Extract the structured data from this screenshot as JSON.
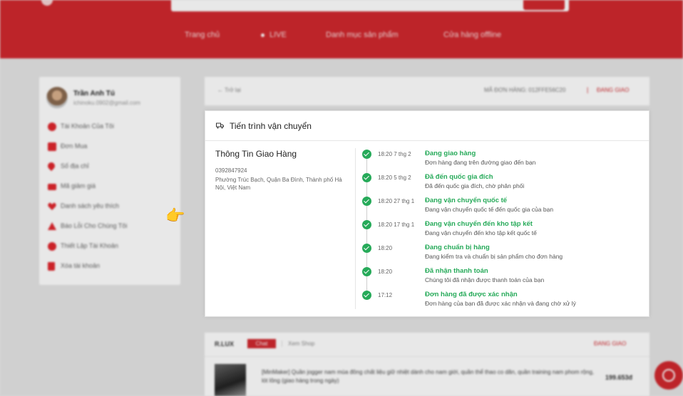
{
  "header": {
    "nav": [
      {
        "label": "Trang chủ"
      },
      {
        "label": "LIVE"
      },
      {
        "label": "Danh mục sản phẩm"
      },
      {
        "label": "Cửa hàng offline"
      }
    ]
  },
  "profile": {
    "name": "Trần Anh Tú",
    "email": "ichinoku.0902@gmail.com"
  },
  "sidebar": {
    "items": [
      {
        "label": "Tài Khoản Của Tôi",
        "icon": "user-circle-icon"
      },
      {
        "label": "Đơn Mua",
        "icon": "clipboard-icon"
      },
      {
        "label": "Số địa chỉ",
        "icon": "location-pin-icon"
      },
      {
        "label": "Mã giảm giá",
        "icon": "ticket-icon"
      },
      {
        "label": "Danh sách yêu thích",
        "icon": "heart-icon"
      },
      {
        "label": "Báo Lỗi Cho Chúng Tôi",
        "icon": "warning-icon"
      },
      {
        "label": "Thiết Lập Tài Khoản",
        "icon": "settings-icon"
      },
      {
        "label": "Xóa tài khoản",
        "icon": "trash-icon"
      }
    ]
  },
  "order_bar": {
    "back_label": "← Trở lại",
    "order_id": "MÃ ĐƠN HÀNG: 012FFE56C20",
    "separator": "|",
    "status": "ĐANG GIAO"
  },
  "shipping": {
    "title": "Tiến trình vận chuyển",
    "info_title": "Thông Tin Giao Hàng",
    "phone": "0392847924",
    "address": "Phường Trúc Bạch, Quận Ba Đình, Thành phố Hà Nội, Việt Nam",
    "events": [
      {
        "time": "18:20 7 thg 2",
        "status": "Đang giao hàng",
        "desc": "Đơn hàng đang trên đường giao đến bạn"
      },
      {
        "time": "18:20 5 thg 2",
        "status": "Đã đến quốc gia đích",
        "desc": "Đã đến quốc gia đích, chờ phân phối"
      },
      {
        "time": "18:20 27 thg 1",
        "status": "Đang vận chuyển quốc tế",
        "desc": "Đang vận chuyển quốc tế đến quốc gia của bạn"
      },
      {
        "time": "18:20 17 thg 1",
        "status": "Đang vận chuyển đến kho tập kết",
        "desc": "Đang vận chuyển đến kho tập kết quốc tế"
      },
      {
        "time": "18:20",
        "status": "Đang chuẩn bị hàng",
        "desc": "Đang kiểm tra và chuẩn bị sản phẩm cho đơn hàng"
      },
      {
        "time": "18:20",
        "status": "Đã nhận thanh toán",
        "desc": "Chúng tôi đã nhận được thanh toán của bạn"
      },
      {
        "time": "17:12",
        "status": "Đơn hàng đã được xác nhận",
        "desc": "Đơn hàng của bạn đã được xác nhận và đang chờ xử lý"
      }
    ]
  },
  "shop": {
    "name": "R.LUX",
    "chat_label": "Chat",
    "view_shop_label": "Xem Shop",
    "status": "ĐANG GIAO",
    "product_name": "[MinMaker] Quần jogger nam mùa đông chất liệu giữ nhiệt dành cho nam giới, quần thể thao co dãn, quần training nam phom rộng, lót lông (giao hàng trong ngày)",
    "price": "199.653đ"
  },
  "colors": {
    "brand_red": "#d0282e",
    "success_green": "#26aa59"
  }
}
